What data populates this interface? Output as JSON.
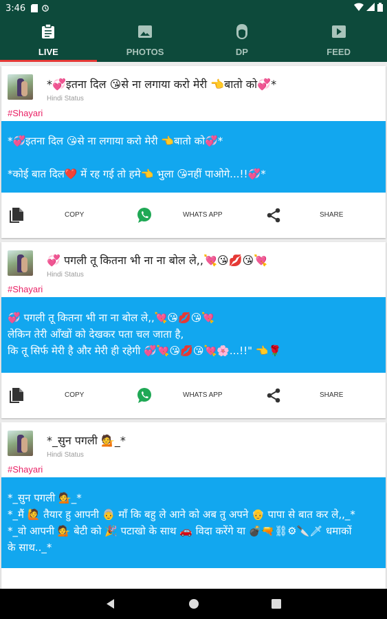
{
  "status_bar": {
    "time": "3:46"
  },
  "tabs": [
    {
      "label": "LIVE",
      "icon": "clipboard-icon",
      "active": true
    },
    {
      "label": "PHOTOS",
      "icon": "image-icon",
      "active": false
    },
    {
      "label": "DP",
      "icon": "face-icon",
      "active": false
    },
    {
      "label": "FEED",
      "icon": "play-icon",
      "active": false
    }
  ],
  "posts": [
    {
      "title": "*💞इतना दिल 😘से ना लगाया करो मेरी 👈बातो को💞*",
      "subtitle": "Hindi Status",
      "tag": "#Shayari",
      "body_lines": [
        "*💞इतना दिल 😘से ना लगाया करो मेरी 👈बातो को💞*",
        "",
        "*कोई बात दिल❤️ में रह गई तो हमे👈 भुला 😘नहीं पाओगे...!!💞*"
      ],
      "actions": {
        "copy": "COPY",
        "whatsapp": "WHATS APP",
        "share": "SHARE"
      }
    },
    {
      "title": "💞 पगली तू कितना भी ना ना बोल ले,,💘😘💋😘💘",
      "subtitle": "Hindi Status",
      "tag": "#Shayari",
      "body_lines": [
        "💞 पगली तू कितना भी ना ना बोल ले,,💘😘💋😘💘",
        "लेकिन तेरी आँखों को देखकर पता चल जाता है,",
        "कि तू सिर्फ मेरी है और मेरी ही रहेगी 💞💘😘💋😘💘🌸...!!\" 👈🌹"
      ],
      "actions": {
        "copy": "COPY",
        "whatsapp": "WHATS APP",
        "share": "SHARE"
      }
    },
    {
      "title": "*_सुन पगली 💁_*",
      "subtitle": "Hindi Status",
      "tag": "#Shayari",
      "body_lines": [
        "*_सुन पगली 💁_*",
        "*_मैं 🙋 तैयार हु आपनी 👵 माँ कि बहु ले आने को अब तु अपने 👴 पापा से बात कर ले,,_*",
        "*_वो आपनी 💁 बेटी को 🎉 पटाखो के साथ 🚗 विदा करेंगे या 💣🔫⛓⚙🔪🗡 धमाकों",
        "के साथ.._*"
      ]
    }
  ],
  "colors": {
    "primary_dark": "#0d4a3b",
    "accent": "#e53935",
    "body_bg": "#12a7ef",
    "tag": "#e91e63",
    "whatsapp": "#1fa855"
  }
}
